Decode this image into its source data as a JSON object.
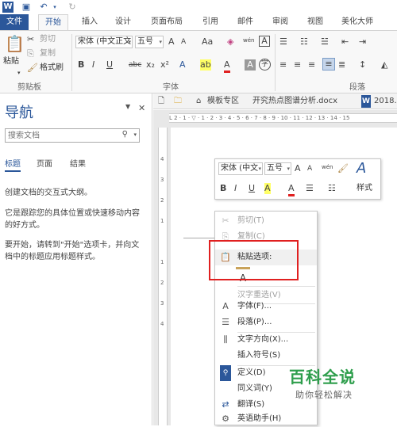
{
  "titlebar": {
    "icons": [
      "word-logo-icon",
      "save-icon",
      "undo-icon",
      "undo-dropdown-icon",
      "redo-icon"
    ]
  },
  "tabs": [
    "文件",
    "开始",
    "插入",
    "设计",
    "页面布局",
    "引用",
    "邮件",
    "审阅",
    "视图",
    "美化大师"
  ],
  "ribbon": {
    "clipboard": {
      "paste": "粘贴",
      "cut": "剪切",
      "copy": "复制",
      "format_painter": "格式刷",
      "group_label": "剪贴板"
    },
    "font": {
      "font_name": "宋体 (中文正文",
      "font_size": "五号",
      "group_label": "字体",
      "row1": [
        "A",
        "A",
        "Aa",
        "wén",
        "A"
      ],
      "row2": [
        "B",
        "I",
        "U",
        "abc",
        "x₂",
        "x²",
        "A",
        "ab",
        "A",
        "A",
        "字"
      ]
    },
    "paragraph": {
      "group_label": "段落"
    }
  },
  "nav": {
    "title": "导航",
    "search_placeholder": "搜索文档",
    "tabs": [
      "标题",
      "页面",
      "结果"
    ],
    "line1": "创建文档的交互式大纲。",
    "line2a": "它是跟踪您的具体位置或快速移动内容",
    "line2b": "的好方式。",
    "line3a": "要开始，请转到\"开始\"选项卡，并向文",
    "line3b": "档中的标题应用标题样式。"
  },
  "doctabs": {
    "tab1": "模板专区",
    "tab2": "开究热点图谱分析.docx",
    "tab3": "2018."
  },
  "ruler": {
    "top_scale": "L   2 · 1 · ▽ · 1 · 2 · 3 · 4 · 5 · 6 · 7 · 8 · 9 · 10 · 11 · 12 · 13 · 14 · 15",
    "vertical": [
      "4",
      "3",
      "2",
      "1",
      "1",
      "2",
      "3",
      "4"
    ]
  },
  "minitoolbar": {
    "font": "宋体 (中文",
    "size": "五号",
    "styles": "样式",
    "row1": [
      "A",
      "A",
      "wén",
      "A"
    ],
    "row2": [
      "B",
      "I",
      "U",
      "A",
      "A"
    ]
  },
  "contextmenu": {
    "cut": "剪切(T)",
    "copy": "复制(C)",
    "paste_options": "粘贴选项:",
    "paste_glyph": "A",
    "reconvert": "汉字重选(V)",
    "font": "字体(F)...",
    "paragraph": "段落(P)...",
    "text_direction": "文字方向(X)...",
    "insert_symbol": "插入符号(S)",
    "define": "定义(D)",
    "synonyms": "同义词(Y)",
    "translate": "翻译(S)",
    "english_assistant": "英语助手(H)"
  },
  "watermark": {
    "logo": "百科全说",
    "sub": "助你轻松解决"
  },
  "colors": {
    "accent": "#2b579a",
    "highlight_box": "#e02020",
    "watermark": "#2e9e4c"
  }
}
